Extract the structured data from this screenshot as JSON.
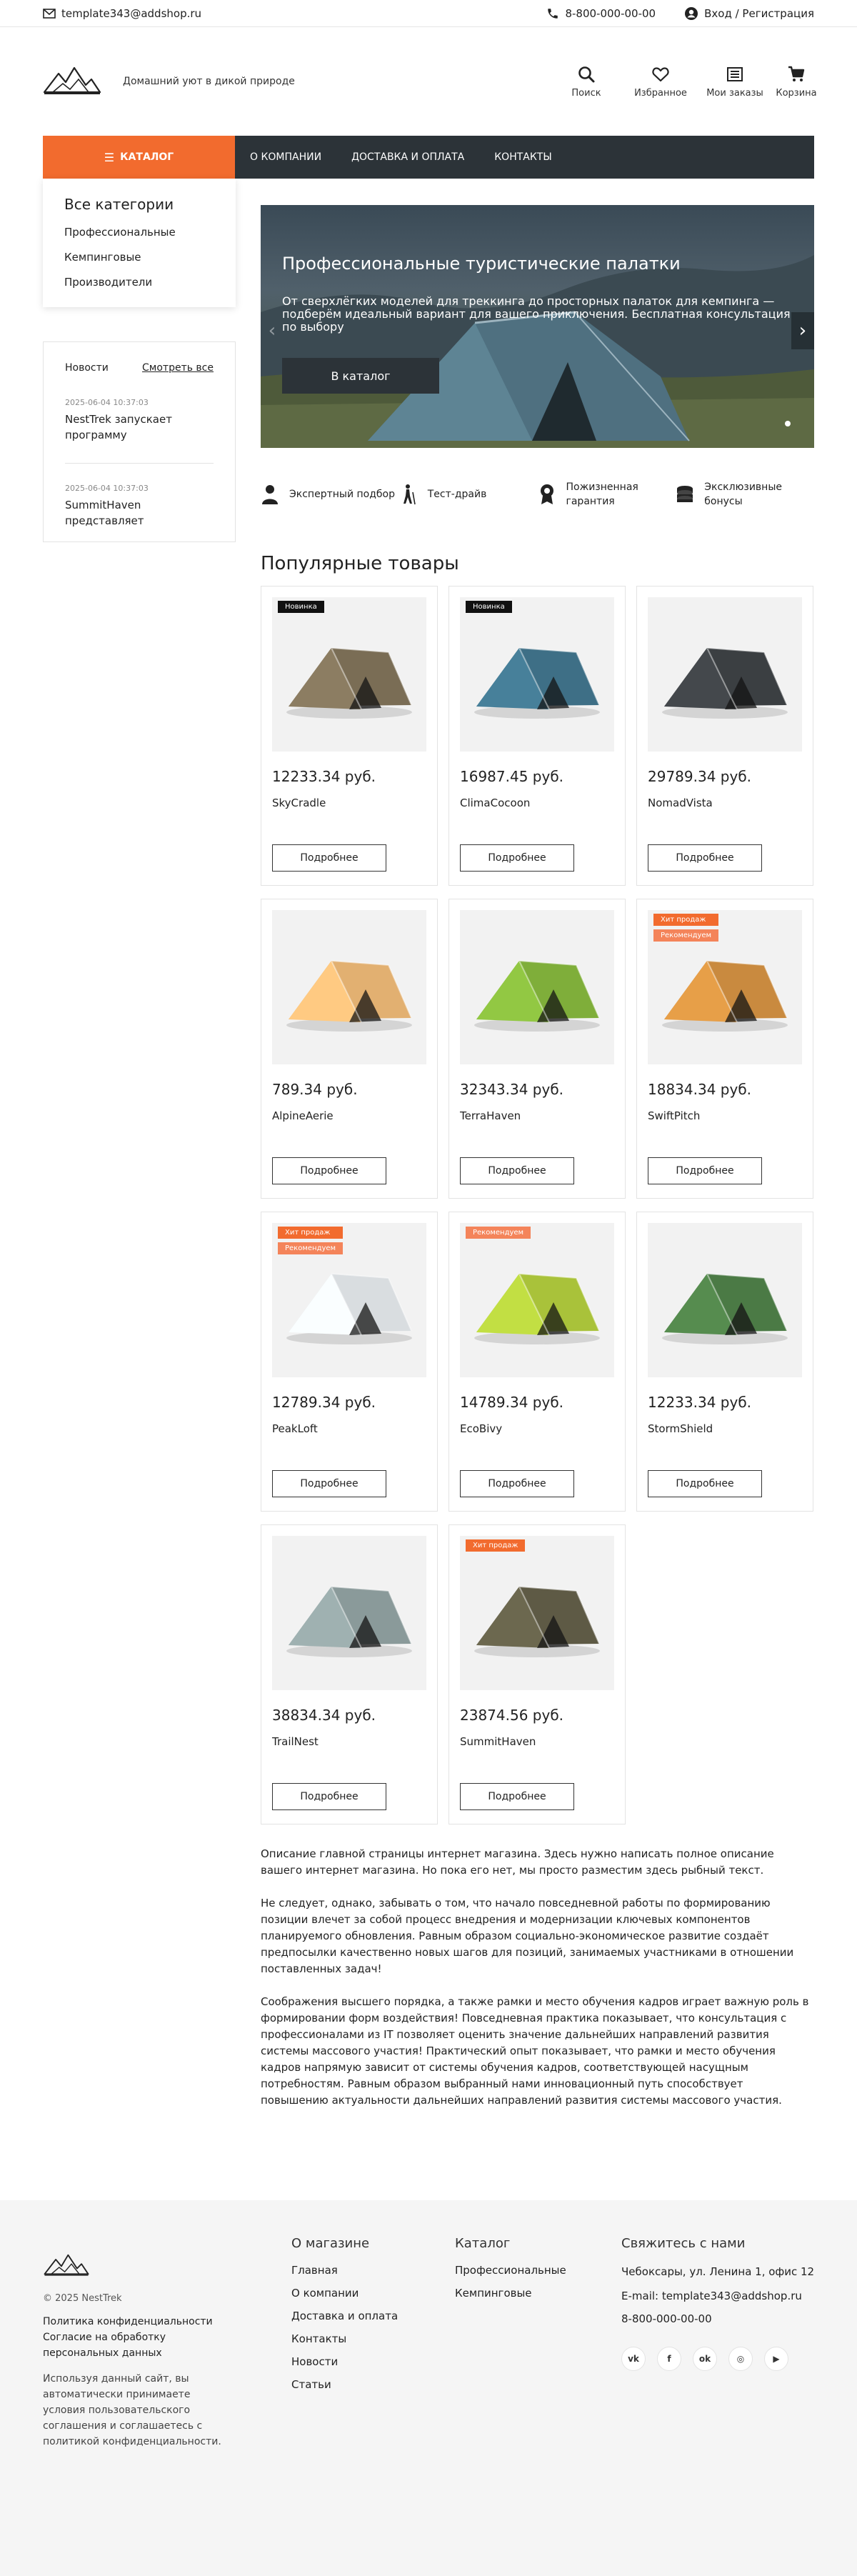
{
  "topbar": {
    "email": "template343@addshop.ru",
    "phone": "8-800-000-00-00",
    "login": "Вход / Регистрация"
  },
  "header": {
    "slogan": "Домашний уют в дикой природе",
    "icons": [
      {
        "label": "Поиск",
        "icon": "search-icon"
      },
      {
        "label": "Избранное",
        "icon": "heart-icon"
      },
      {
        "label": "Мои заказы",
        "icon": "orders-icon"
      },
      {
        "label": "Корзина",
        "icon": "cart-icon"
      }
    ]
  },
  "nav": {
    "catalog_label": "КАТАЛОГ",
    "links": [
      "О КОМПАНИИ",
      "ДОСТАВКА И ОПЛАТА",
      "КОНТАКТЫ"
    ]
  },
  "sidebar": {
    "categories_title": "Все категории",
    "categories": [
      "Профессиональные",
      "Кемпинговые",
      "Производители"
    ],
    "news_title": "Новости",
    "news_all": "Смотреть все",
    "news": [
      {
        "date": "2025-06-04 10:37:03",
        "title": "NestTrek запускает программу"
      },
      {
        "date": "2025-06-04 10:37:03",
        "title": "SummitHaven представляет"
      }
    ]
  },
  "banner": {
    "title": "Профессиональные туристические палатки",
    "text": "От сверхлёгких моделей для треккинга до просторных палаток для кемпинга — подберём идеальный вариант для вашего приключения. Бесплатная консультация по выбору",
    "button": "В каталог"
  },
  "advantages": [
    {
      "label": "Экспертный подбор",
      "icon": "person-icon"
    },
    {
      "label": "Тест-драйв",
      "icon": "hiker-icon"
    },
    {
      "label": "Пожизненная гарантия",
      "icon": "award-icon"
    },
    {
      "label": "Эксклюзивные бонусы",
      "icon": "coins-icon"
    }
  ],
  "products_title": "Популярные товары",
  "more_label": "Подробнее",
  "products": [
    {
      "name": "SkyCradle",
      "price": "12233.34 руб.",
      "badges": [
        "Новинка"
      ],
      "color": "#7a6d55"
    },
    {
      "name": "ClimaCocoon",
      "price": "16987.45 руб.",
      "badges": [
        "Новинка"
      ],
      "color": "#3e6f86"
    },
    {
      "name": "NomadVista",
      "price": "29789.34 руб.",
      "badges": [],
      "color": "#3b3f42"
    },
    {
      "name": "AlpineAerie",
      "price": "789.34 руб.",
      "badges": [],
      "color": "#e2b071"
    },
    {
      "name": "TerraHaven",
      "price": "32343.34 руб.",
      "badges": [],
      "color": "#7fae3a"
    },
    {
      "name": "SwiftPitch",
      "price": "18834.34 руб.",
      "badges": [
        "Хит продаж",
        "Рекомендуем"
      ],
      "color": "#c98a3f"
    },
    {
      "name": "PeakLoft",
      "price": "12789.34 руб.",
      "badges": [
        "Хит продаж",
        "Рекомендуем"
      ],
      "color": "#d9dde0"
    },
    {
      "name": "EcoBivy",
      "price": "14789.34 руб.",
      "badges": [
        "Рекомендуем"
      ],
      "color": "#a9c23a"
    },
    {
      "name": "StormShield",
      "price": "12233.34 руб.",
      "badges": [],
      "color": "#4b7a45"
    },
    {
      "name": "TrailNest",
      "price": "38834.34 руб.",
      "badges": [],
      "color": "#8a9a9a"
    },
    {
      "name": "SummitHaven",
      "price": "23874.56 руб.",
      "badges": [
        "Хит продаж"
      ],
      "color": "#5e5a45"
    }
  ],
  "description": [
    "Описание главной страницы интернет магазина. Здесь нужно написать полное описание вашего интернет магазина. Но пока его нет, мы просто разместим здесь рыбный текст.",
    "Не следует, однако, забывать о том, что начало повседневной работы по формированию позиции влечет за собой процесс внедрения и модернизации ключевых компонентов планируемого обновления. Равным образом социально-экономическое развитие создаёт предпосылки качественно новых шагов для позиций, занимаемых участниками в отношении поставленных задач!",
    "Соображения высшего порядка, а также рамки и место обучения кадров играет важную роль в формировании форм воздействия! Повседневная практика показывает, что консультация с профессионалами из IT позволяет оценить значение дальнейших направлений развития системы массового участия! Практический опыт показывает, что рамки и место обучения кадров напрямую зависит от системы обучения кадров, соответствующей насущным потребностям. Равным образом выбранный нами инновационный путь способствует повышению актуальности дальнейших направлений развития системы массового участия."
  ],
  "footer": {
    "copyright": "© 2025 NestTrek",
    "legal": [
      "Политика конфиденциальности",
      "Согласие на обработку персональных данных"
    ],
    "note": "Используя данный сайт, вы автоматически принимаете условия пользовательского соглашения и соглашаетесь с политикой конфиденциальности.",
    "about_title": "О магазине",
    "about_links": [
      "Главная",
      "О компании",
      "Доставка и оплата",
      "Контакты",
      "Новости",
      "Статьи"
    ],
    "catalog_title": "Каталог",
    "catalog_links": [
      "Профессиональные",
      "Кемпинговые"
    ],
    "contacts_title": "Свяжитесь с нами",
    "address": "Чебоксары, ул. Ленина 1, офис 12",
    "email_label": "E-mail: template343@addshop.ru",
    "phone": "8-800-000-00-00",
    "socials": [
      {
        "label": "vk",
        "icon": "vk-icon"
      },
      {
        "label": "f",
        "icon": "facebook-icon"
      },
      {
        "label": "ok",
        "icon": "ok-icon"
      },
      {
        "label": "◎",
        "icon": "instagram-icon"
      },
      {
        "label": "▶",
        "icon": "youtube-icon"
      }
    ]
  }
}
